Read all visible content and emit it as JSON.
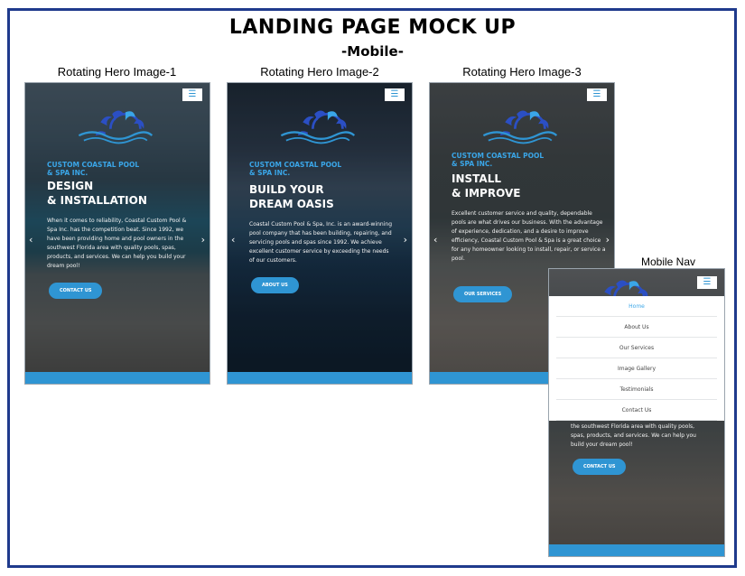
{
  "header": {
    "title": "LANDING PAGE MOCK UP",
    "subtitle": "-Mobile-"
  },
  "screens": [
    {
      "caption": "Rotating Hero Image-1",
      "brand": "CUSTOM COASTAL POOL\n& SPA INC.",
      "headline_line1": "DESIGN",
      "headline_line2": "& INSTALLATION",
      "body": "When it comes to reliability, Coastal Custom Pool & Spa Inc. has the competition beat. Since 1992, we have been providing home and pool owners in the southwest Florida area with quality pools, spas, products, and services. We can help you build your dream pool!",
      "cta": "CONTACT US"
    },
    {
      "caption": "Rotating Hero Image-2",
      "brand": "CUSTOM COASTAL POOL\n& SPA INC.",
      "headline_line1": "BUILD YOUR",
      "headline_line2": "DREAM OASIS",
      "body": "Coastal Custom Pool & Spa, Inc. is an award-winning pool company that has been building, repairing, and servicing pools and spas since 1992. We achieve excellent customer service by exceeding the needs of our customers.",
      "cta": "ABOUT US"
    },
    {
      "caption": "Rotating Hero Image-3",
      "brand": "CUSTOM COASTAL POOL\n& SPA INC.",
      "headline_line1": "INSTALL",
      "headline_line2": "& IMPROVE",
      "body": "Excellent customer service and quality, dependable pools are what drives our business. With the advantage of experience, dedication, and a desire to improve efficiency, Coastal Custom Pool & Spa is a great choice for any homeowner looking to install, repair, or service a pool.",
      "cta": "OUR SERVICES"
    }
  ],
  "mobile_nav": {
    "caption": "Mobile Nav",
    "items": [
      "Home",
      "About Us",
      "Our Services",
      "Image Gallery",
      "Testimonials",
      "Contact Us"
    ],
    "active_index": 0,
    "body_tail": "the southwest Florida area with quality pools, spas, products, and services. We can help you build your dream pool!",
    "cta": "CONTACT US"
  },
  "icons": {
    "menu": "hamburger-icon",
    "prev": "chevron-left-icon",
    "next": "chevron-right-icon",
    "logo": "sun-wave-logo"
  },
  "colors": {
    "accent": "#2f95d3",
    "brand_text": "#3aa6e8",
    "frame": "#1f3a8c"
  }
}
